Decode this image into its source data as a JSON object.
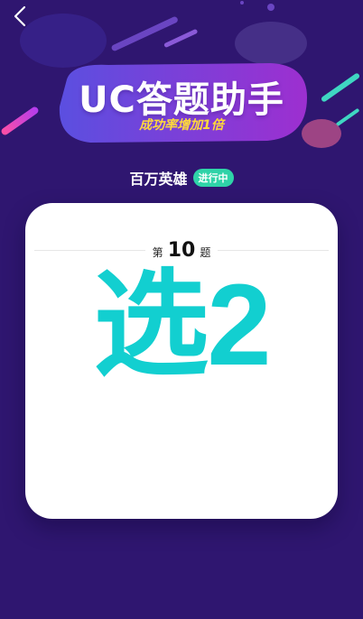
{
  "header": {
    "title": "UC答题助手",
    "subtitle": "成功率增加1倍"
  },
  "game": {
    "name": "百万英雄",
    "status": "进行中"
  },
  "question": {
    "prefix": "第",
    "number": "10",
    "suffix": "题"
  },
  "answer": {
    "text": "选2"
  },
  "colors": {
    "background": "#2f1670",
    "accent": "#12cfd0",
    "badge": "#2fd3a8",
    "subtitle": "#ffd93b"
  },
  "icons": {
    "back": "chevron-left-icon"
  }
}
